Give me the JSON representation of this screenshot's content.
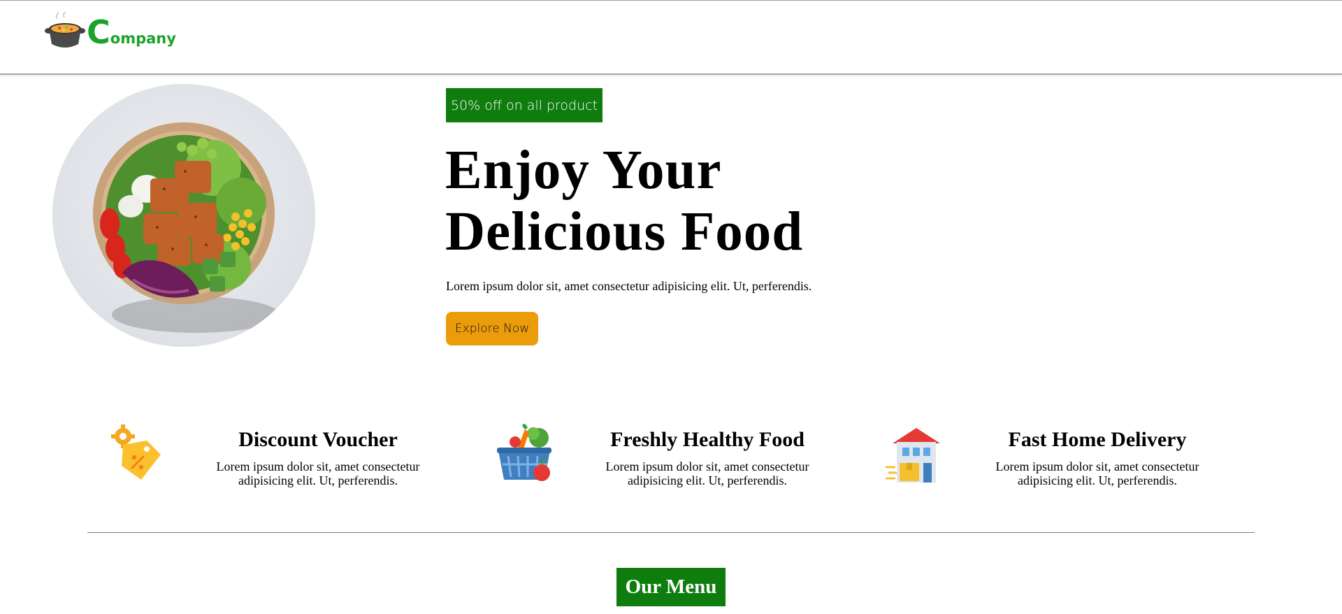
{
  "header": {
    "logo_letter": "C",
    "logo_rest": "ompany",
    "logo_icon": "cooking-pot-icon"
  },
  "hero": {
    "image": "salad-bowl-image",
    "badge": "50% off on all product",
    "title_line1": "Enjoy Your",
    "title_line2": "Delicious Food",
    "description": "Lorem ipsum dolor sit, amet consectetur adipisicing elit. Ut, perferendis.",
    "cta_label": "Explore Now"
  },
  "features": [
    {
      "icon": "discount-tag-icon",
      "title": "Discount Voucher",
      "desc_line1": "Lorem ipsum dolor sit, amet consectetur",
      "desc_line2": "adipisicing elit. Ut, perferendis."
    },
    {
      "icon": "grocery-basket-icon",
      "title": "Freshly Healthy Food",
      "desc_line1": "Lorem ipsum dolor sit, amet consectetur",
      "desc_line2": "adipisicing elit. Ut, perferendis."
    },
    {
      "icon": "home-delivery-icon",
      "title": "Fast Home Delivery",
      "desc_line1": "Lorem ipsum dolor sit, amet consectetur",
      "desc_line2": "adipisicing elit. Ut, perferendis."
    }
  ],
  "menu_section": {
    "title": "Our Menu"
  },
  "colors": {
    "brand_green": "#1aa32a",
    "badge_green": "#0e7d0e",
    "cta_orange": "#eb9c0b"
  }
}
